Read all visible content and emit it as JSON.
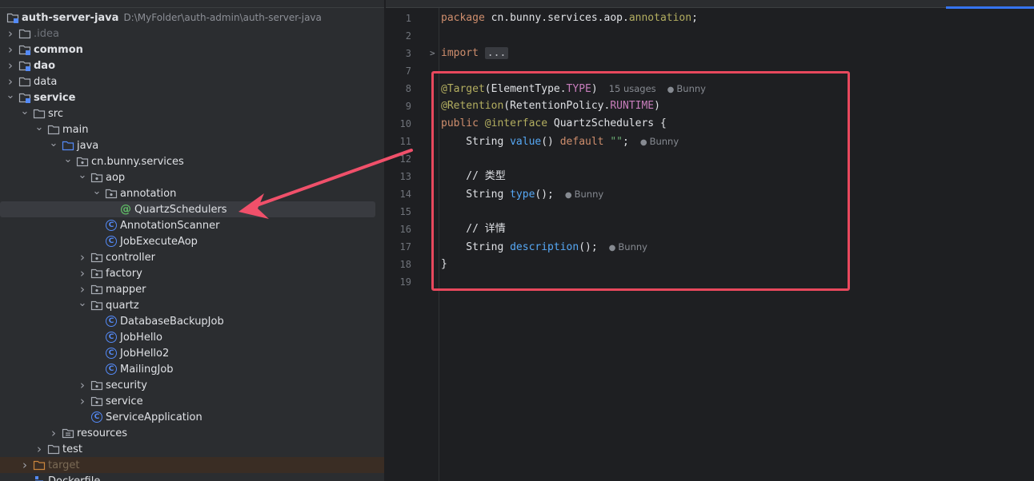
{
  "project": {
    "name": "auth-server-java",
    "path": "D:\\MyFolder\\auth-admin\\auth-server-java",
    "nodes": [
      {
        "label": ".idea",
        "depth": 0,
        "chev": ">",
        "icon": "folder",
        "style": "dim"
      },
      {
        "label": "common",
        "depth": 0,
        "chev": ">",
        "icon": "module",
        "style": "bold"
      },
      {
        "label": "dao",
        "depth": 0,
        "chev": ">",
        "icon": "module",
        "style": "bold"
      },
      {
        "label": "data",
        "depth": 0,
        "chev": ">",
        "icon": "folder",
        "style": ""
      },
      {
        "label": "service",
        "depth": 0,
        "chev": "v",
        "icon": "module",
        "style": "bold"
      },
      {
        "label": "src",
        "depth": 1,
        "chev": "v",
        "icon": "folder",
        "style": ""
      },
      {
        "label": "main",
        "depth": 2,
        "chev": "v",
        "icon": "folder",
        "style": ""
      },
      {
        "label": "java",
        "depth": 3,
        "chev": "v",
        "icon": "source",
        "style": ""
      },
      {
        "label": "cn.bunny.services",
        "depth": 4,
        "chev": "v",
        "icon": "package",
        "style": ""
      },
      {
        "label": "aop",
        "depth": 5,
        "chev": "v",
        "icon": "package",
        "style": ""
      },
      {
        "label": "annotation",
        "depth": 6,
        "chev": "v",
        "icon": "package",
        "style": ""
      },
      {
        "label": "QuartzSchedulers",
        "depth": 7,
        "chev": "",
        "icon": "annotation",
        "style": "selected"
      },
      {
        "label": "AnnotationScanner",
        "depth": 6,
        "chev": "",
        "icon": "class",
        "style": ""
      },
      {
        "label": "JobExecuteAop",
        "depth": 6,
        "chev": "",
        "icon": "class",
        "style": ""
      },
      {
        "label": "controller",
        "depth": 5,
        "chev": ">",
        "icon": "package",
        "style": ""
      },
      {
        "label": "factory",
        "depth": 5,
        "chev": ">",
        "icon": "package",
        "style": ""
      },
      {
        "label": "mapper",
        "depth": 5,
        "chev": ">",
        "icon": "package",
        "style": ""
      },
      {
        "label": "quartz",
        "depth": 5,
        "chev": "v",
        "icon": "package",
        "style": ""
      },
      {
        "label": "DatabaseBackupJob",
        "depth": 6,
        "chev": "",
        "icon": "class",
        "style": ""
      },
      {
        "label": "JobHello",
        "depth": 6,
        "chev": "",
        "icon": "class",
        "style": ""
      },
      {
        "label": "JobHello2",
        "depth": 6,
        "chev": "",
        "icon": "class",
        "style": ""
      },
      {
        "label": "MailingJob",
        "depth": 6,
        "chev": "",
        "icon": "class",
        "style": ""
      },
      {
        "label": "security",
        "depth": 5,
        "chev": ">",
        "icon": "package",
        "style": ""
      },
      {
        "label": "service",
        "depth": 5,
        "chev": ">",
        "icon": "package",
        "style": ""
      },
      {
        "label": "ServiceApplication",
        "depth": 5,
        "chev": "",
        "icon": "spring-class",
        "style": ""
      },
      {
        "label": "resources",
        "depth": 3,
        "chev": ">",
        "icon": "resources",
        "style": ""
      },
      {
        "label": "test",
        "depth": 2,
        "chev": ">",
        "icon": "folder",
        "style": ""
      },
      {
        "label": "target",
        "depth": 1,
        "chev": ">",
        "icon": "excluded-folder",
        "style": "excluded"
      },
      {
        "label": "Dockerfile",
        "depth": 1,
        "chev": "",
        "icon": "docker",
        "style": ""
      }
    ]
  },
  "editor": {
    "lines": [
      {
        "n": "1",
        "tokens": [
          [
            "kw",
            "package "
          ],
          [
            "",
            "cn.bunny.services.aop."
          ],
          [
            "an",
            "annotation"
          ],
          [
            "",
            ";"
          ]
        ]
      },
      {
        "n": "2",
        "tokens": []
      },
      {
        "n": "3",
        "fold": ">",
        "tokens": [
          [
            "kw",
            "import "
          ],
          [
            "fold-box",
            "..."
          ]
        ]
      },
      {
        "n": "7",
        "tokens": []
      },
      {
        "n": "8",
        "tokens": [
          [
            "an",
            "@Target"
          ],
          [
            "",
            "(ElementType."
          ],
          [
            "cst",
            "TYPE"
          ],
          [
            "",
            ")"
          ]
        ],
        "hint": "15 usages",
        "author": "Bunny"
      },
      {
        "n": "9",
        "tokens": [
          [
            "an",
            "@Retention"
          ],
          [
            "",
            "(RetentionPolicy."
          ],
          [
            "cst",
            "RUNTIME"
          ],
          [
            "",
            ")"
          ]
        ]
      },
      {
        "n": "10",
        "tokens": [
          [
            "kw",
            "public "
          ],
          [
            "an",
            "@interface "
          ],
          [
            "",
            "QuartzSchedulers {"
          ]
        ]
      },
      {
        "n": "11",
        "tokens": [
          [
            "",
            "    String "
          ],
          [
            "fn",
            "value"
          ],
          [
            "",
            "() "
          ],
          [
            "kw",
            "default "
          ],
          [
            "str",
            "\"\""
          ],
          [
            "",
            ";"
          ]
        ],
        "author": "Bunny"
      },
      {
        "n": "12",
        "tokens": []
      },
      {
        "n": "13",
        "tokens": [
          [
            "cm",
            "    // 类型"
          ]
        ]
      },
      {
        "n": "14",
        "tokens": [
          [
            "",
            "    String "
          ],
          [
            "fn",
            "type"
          ],
          [
            "",
            "();"
          ]
        ],
        "author": "Bunny"
      },
      {
        "n": "15",
        "tokens": []
      },
      {
        "n": "16",
        "tokens": [
          [
            "cm",
            "    // 详情"
          ]
        ]
      },
      {
        "n": "17",
        "tokens": [
          [
            "",
            "    String "
          ],
          [
            "fn",
            "description"
          ],
          [
            "",
            "();"
          ]
        ],
        "author": "Bunny"
      },
      {
        "n": "18",
        "tokens": [
          [
            "",
            "}"
          ]
        ]
      },
      {
        "n": "19",
        "tokens": []
      }
    ]
  },
  "colors": {
    "highlight_box": "#e8485d",
    "arrow": "#f0506a",
    "folder": "#a8adb5",
    "source_folder": "#548af7"
  }
}
